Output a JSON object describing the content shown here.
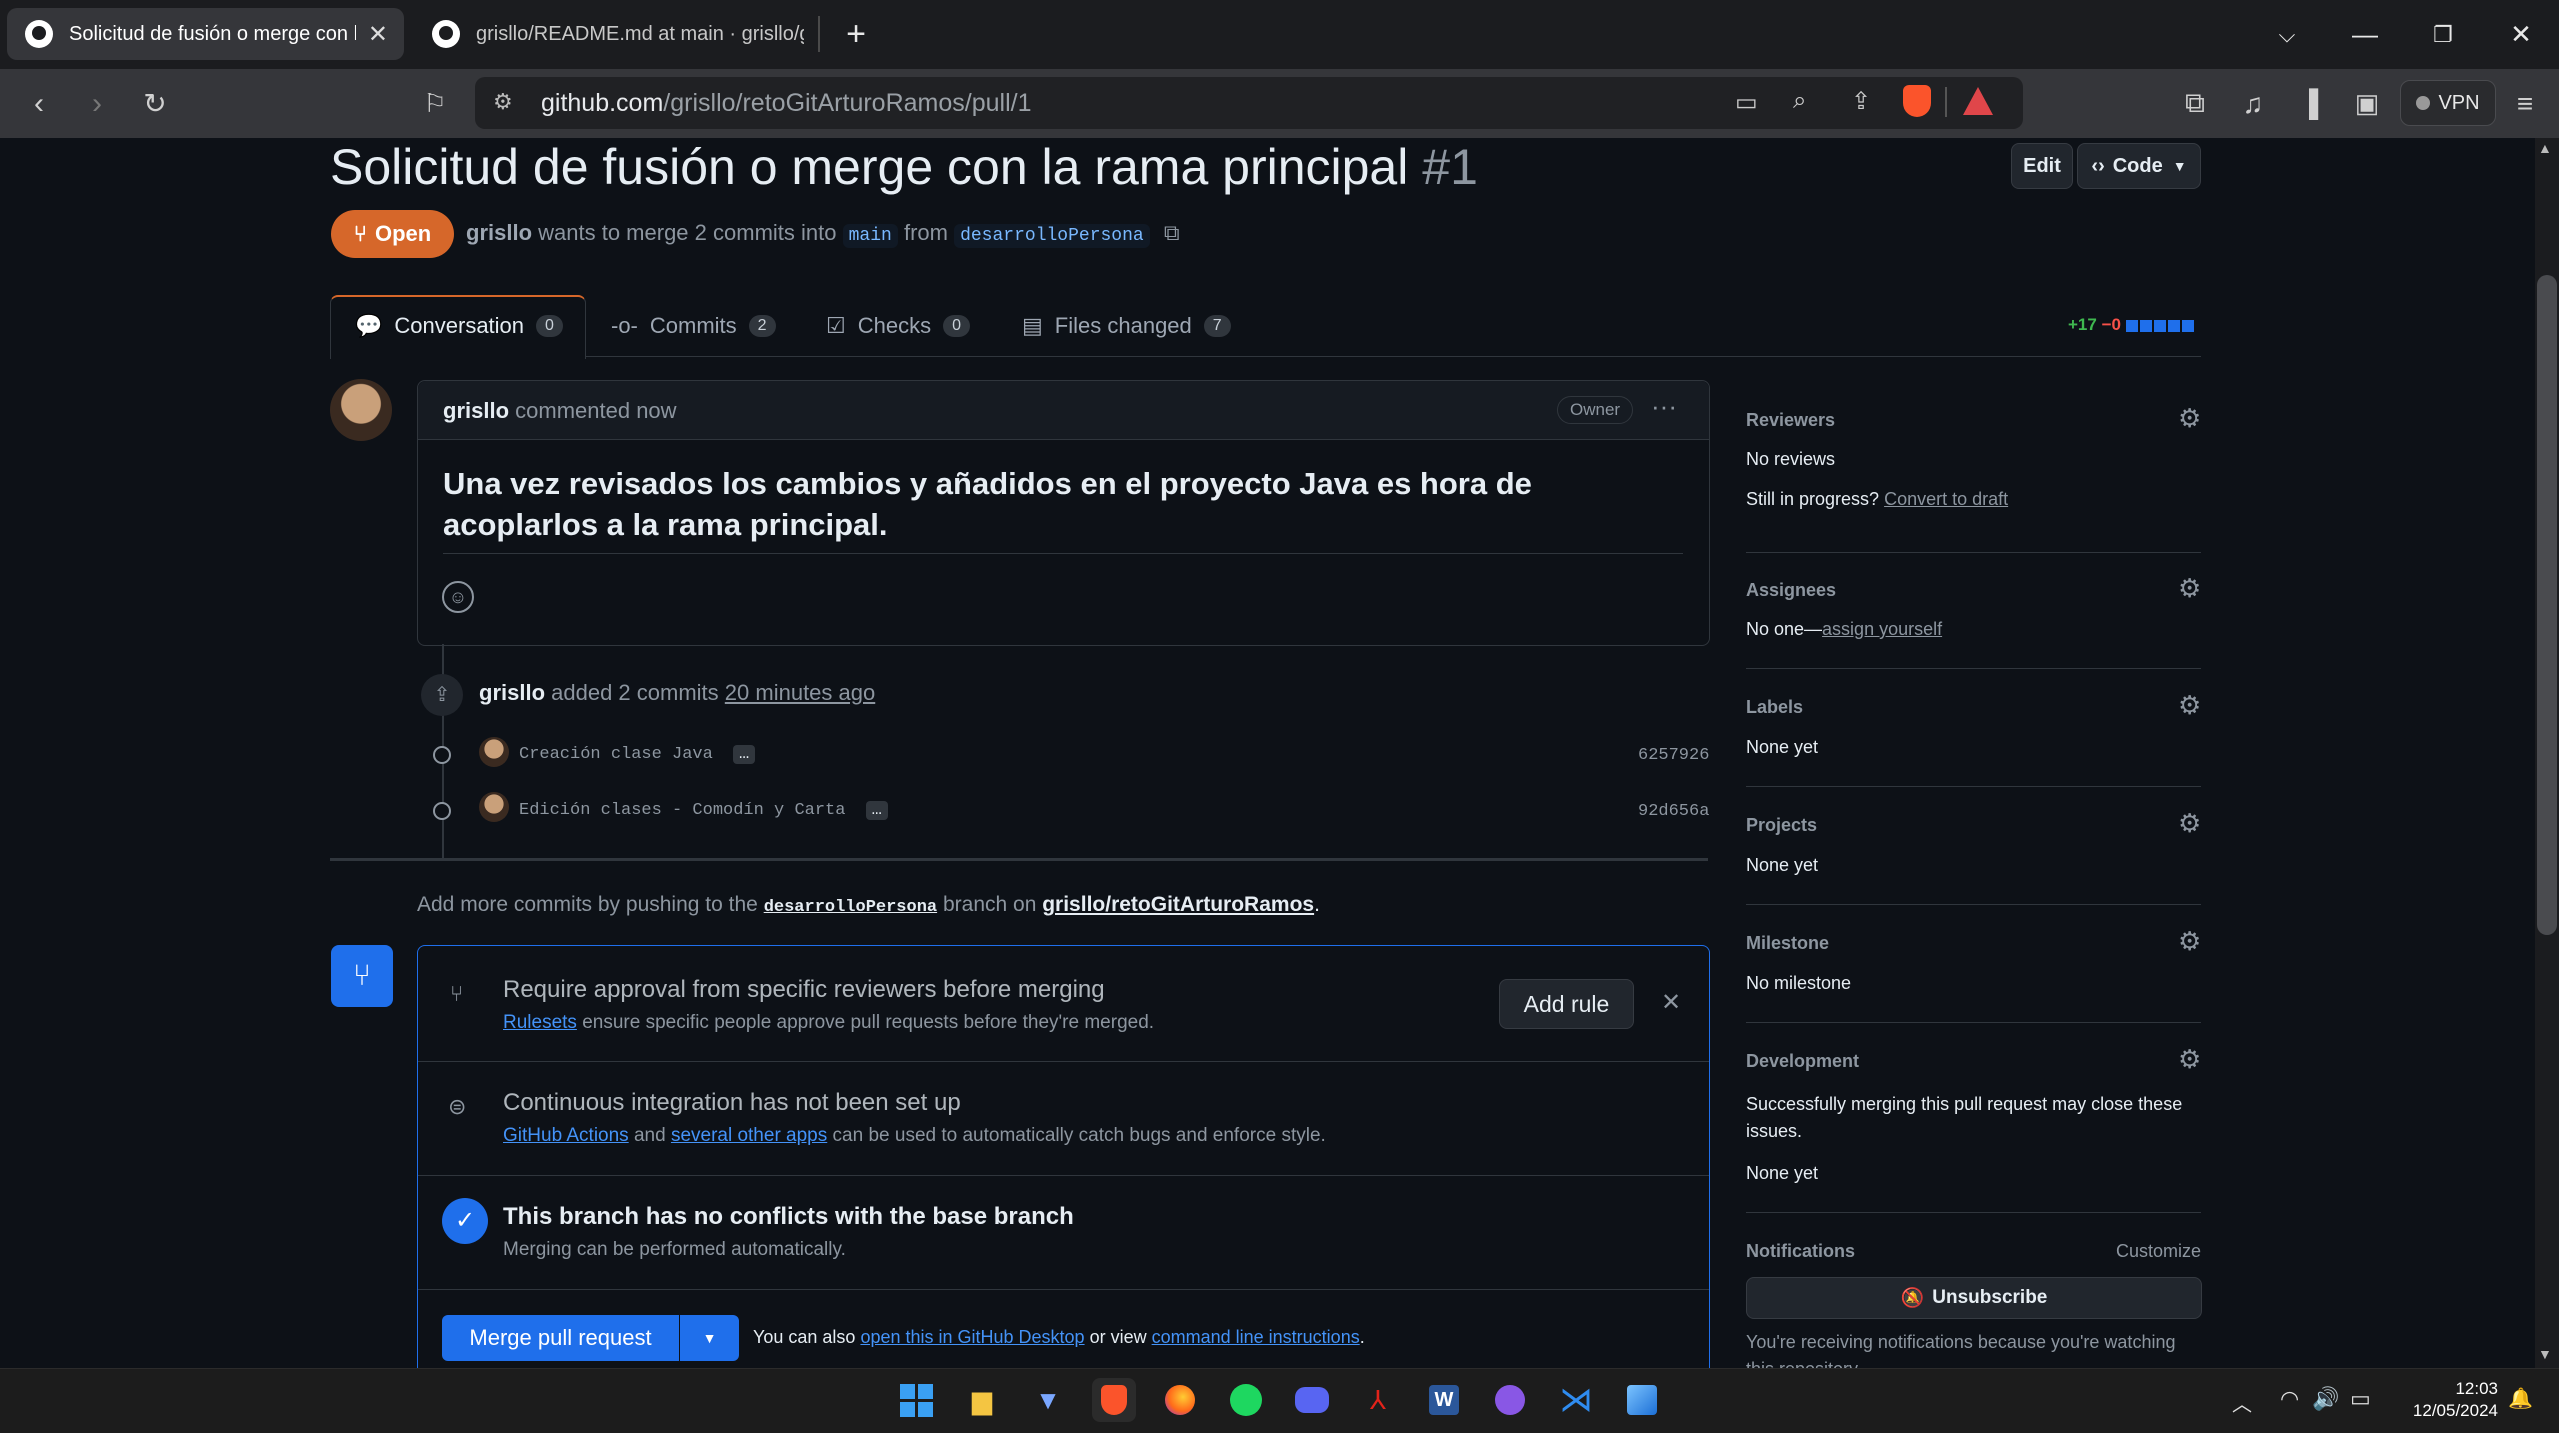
{
  "browser": {
    "tabs": [
      {
        "title": "Solicitud de fusión o merge con la rama principal",
        "active": true
      },
      {
        "title": "grisllo/README.md at main · grisllo/grisllo",
        "active": false
      }
    ],
    "url_host": "github.com",
    "url_path": "/grisllo/retoGitArturoRamos/pull/1",
    "vpn_label": "VPN"
  },
  "pr": {
    "title": "Solicitud de fusión o merge con la rama principal",
    "number": "#1",
    "status": "Open",
    "author": "grisllo",
    "summary_mid": "wants to merge 2 commits into",
    "base_branch": "main",
    "from_word": "from",
    "head_branch": "desarrolloPersona",
    "edit_label": "Edit",
    "code_label": "Code"
  },
  "tabs": [
    {
      "label": "Conversation",
      "count": "0"
    },
    {
      "label": "Commits",
      "count": "2"
    },
    {
      "label": "Checks",
      "count": "0"
    },
    {
      "label": "Files changed",
      "count": "7"
    }
  ],
  "diffstat": {
    "added": "+17",
    "removed": "−0"
  },
  "comment": {
    "author": "grisllo",
    "when": "commented now",
    "role": "Owner",
    "body": "Una vez revisados los cambios y añadidos en el proyecto Java es hora de acoplarlos a la rama principal."
  },
  "commits_event": {
    "author": "grisllo",
    "text": "added 2 commits",
    "when": "20 minutes ago",
    "commits": [
      {
        "message": "Creación clase Java",
        "sha": "6257926"
      },
      {
        "message": "Edición clases - Comodín y Carta",
        "sha": "92d656a"
      }
    ]
  },
  "push_hint": {
    "prefix": "Add more commits by pushing to the",
    "branch": "desarrolloPersona",
    "mid": "branch on",
    "repo": "grisllo/retoGitArturoRamos"
  },
  "merge_box": {
    "rule_title": "Require approval from specific reviewers before merging",
    "rule_link": "Rulesets",
    "rule_desc": "ensure specific people approve pull requests before they're merged.",
    "add_rule": "Add rule",
    "ci_title": "Continuous integration has not been set up",
    "ci_link1": "GitHub Actions",
    "ci_and": "and",
    "ci_link2": "several other apps",
    "ci_desc": "can be used to automatically catch bugs and enforce style.",
    "conflict_title": "This branch has no conflicts with the base branch",
    "conflict_desc": "Merging can be performed automatically.",
    "merge_button": "Merge pull request",
    "also_text": "You can also",
    "desktop_link": "open this in GitHub Desktop",
    "or_view": "or view",
    "cli_link": "command line instructions",
    "period": "."
  },
  "sidebar": {
    "reviewers_h": "Reviewers",
    "reviewers_v": "No reviews",
    "progress_q": "Still in progress?",
    "draft_link": "Convert to draft",
    "assignees_h": "Assignees",
    "assignees_v": "No one—",
    "assign_link": "assign yourself",
    "labels_h": "Labels",
    "labels_v": "None yet",
    "projects_h": "Projects",
    "projects_v": "None yet",
    "milestone_h": "Milestone",
    "milestone_v": "No milestone",
    "dev_h": "Development",
    "dev_desc": "Successfully merging this pull request may close these issues.",
    "dev_v": "None yet",
    "notif_h": "Notifications",
    "customize": "Customize",
    "unsubscribe": "Unsubscribe",
    "notif_desc": "You're receiving notifications because you're watching this repository."
  },
  "taskbar": {
    "time": "12:03",
    "date": "12/05/2024"
  },
  "colors": {
    "accent": "#1f6feb",
    "open": "#d6672a",
    "link": "#4493f8"
  }
}
